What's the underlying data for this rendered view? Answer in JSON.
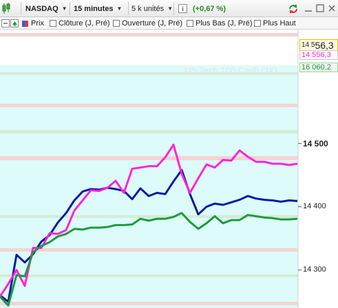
{
  "toolbar": {
    "instrument": "NASDAQ",
    "period": "15 minutes",
    "units": "5 k unités",
    "info_icon_text": "i",
    "change": "(+0,67 %)"
  },
  "indicators": {
    "prix": "Prix",
    "cloture": "Clôture (J, Pré)",
    "ouverture": "Ouverture (J, Pré)",
    "plus_bas": "Plus Bas (J, Pré)",
    "plus_haut": "Plus Haut"
  },
  "watermark": "US Tech 100 Cash (1€)",
  "price_tags": {
    "last_prefix": "14 5",
    "last_big": "56,3",
    "magenta": "14 556,3",
    "green": "16 060,2"
  },
  "price_axis": {
    "labels": [
      {
        "text": "14 500",
        "value": 14500,
        "strong": true
      },
      {
        "text": "14 400",
        "value": 14400,
        "strong": false
      },
      {
        "text": "14 300",
        "value": 14300,
        "strong": false
      }
    ]
  },
  "colors": {
    "magenta": "#ff22dd",
    "navy": "#0a1aa0",
    "green": "#1f9a3c",
    "pink_band": "#f6d3d3",
    "green_band": "#d5ecd5",
    "teal_bg": "#dcfbfa"
  },
  "chart_data": {
    "type": "line",
    "y_unit": "points",
    "ylim": [
      14240,
      14680
    ],
    "series": [
      {
        "color": "#0a1aa0",
        "values": [
          14260,
          14250,
          14324,
          14312,
          14325,
          14345,
          14355,
          14375,
          14390,
          14410,
          14424,
          14428,
          14427,
          14430,
          14428,
          14425,
          14412,
          14429,
          14417,
          14422,
          14420,
          14440,
          14458,
          14420,
          14388,
          14400,
          14405,
          14403,
          14407,
          14411,
          14417,
          14413,
          14411,
          14410,
          14408,
          14410,
          14409
        ]
      },
      {
        "color": "#ff22dd",
        "values": [
          14258,
          14278,
          14300,
          14275,
          14335,
          14335,
          14358,
          14357,
          14363,
          14394,
          14410,
          14426,
          14425,
          14430,
          14441,
          14422,
          14460,
          14462,
          14464,
          14464,
          14478,
          14498,
          14452,
          14422,
          14445,
          14467,
          14462,
          14474,
          14473,
          14489,
          14479,
          14471,
          14471,
          14468,
          14468,
          14466,
          14468
        ]
      },
      {
        "color": "#1f9a3c",
        "values": [
          14258,
          14244,
          14292,
          14290,
          14328,
          14338,
          14344,
          14353,
          14357,
          14365,
          14364,
          14367,
          14367,
          14368,
          14371,
          14371,
          14372,
          14381,
          14378,
          14381,
          14381,
          14384,
          14390,
          14376,
          14365,
          14374,
          14385,
          14374,
          14379,
          14379,
          14387,
          14385,
          14383,
          14382,
          14380,
          14380,
          14381
        ]
      }
    ]
  }
}
